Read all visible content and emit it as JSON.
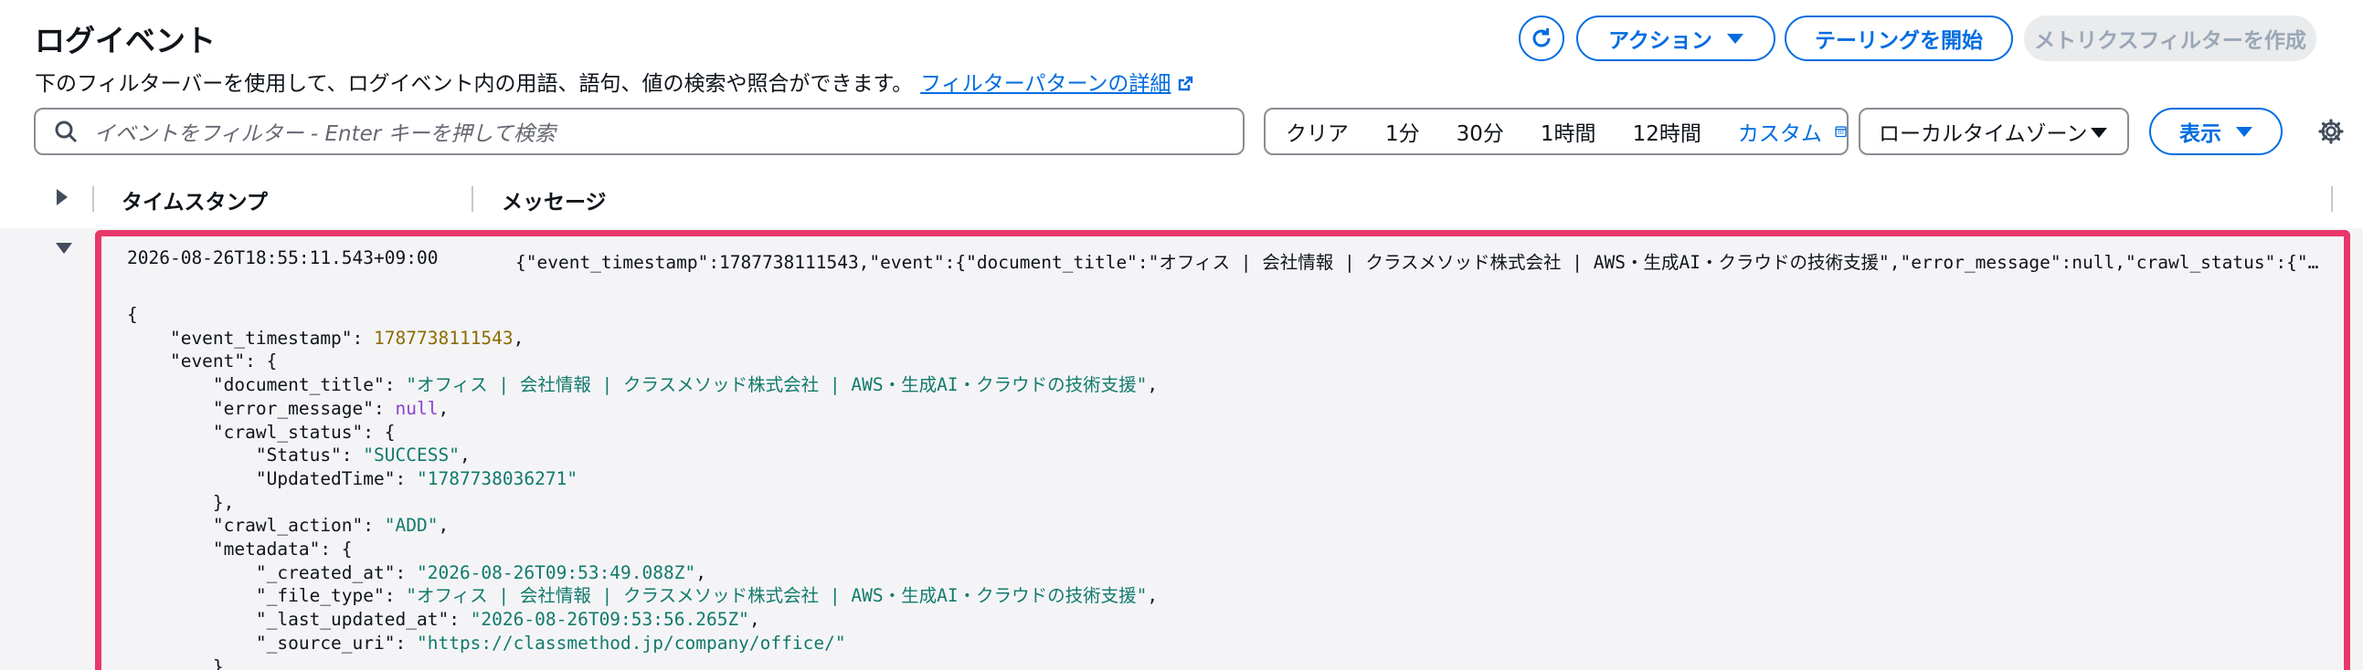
{
  "header": {
    "title": "ログイベント",
    "description": "下のフィルターバーを使用して、ログイベント内の用語、語句、値の検索や照合ができます。",
    "link_label": "フィルターパターンの詳細",
    "actions_label": "アクション",
    "tailing_label": "テーリングを開始",
    "metric_filter_label": "メトリクスフィルターを作成"
  },
  "search": {
    "placeholder": "イベントをフィルター - Enter キーを押して検索"
  },
  "time_range": {
    "clear": "クリア",
    "options": [
      "1分",
      "30分",
      "1時間",
      "12時間"
    ],
    "custom": "カスタム"
  },
  "timezone": {
    "selected": "ローカルタイムゾーン"
  },
  "display_label": "表示",
  "columns": {
    "timestamp": "タイムスタンプ",
    "message": "メッセージ"
  },
  "event": {
    "timestamp": "2026-08-26T18:55:11.543+09:00",
    "message": "{\"event_timestamp\":1787738111543,\"event\":{\"document_title\":\"オフィス | 会社情報 | クラスメソッド株式会社 | AWS・生成AI・クラウドの技術支援\",\"error_message\":null,\"crawl_status\":{\"Status\":\"SUCCESS\",\"UpdatedTime\":\"1787738036271\"}",
    "json": {
      "event_timestamp": "1787738111543",
      "document_title": "\"オフィス | 会社情報 | クラスメソッド株式会社 | AWS・生成AI・クラウドの技術支援\"",
      "error_message": "null",
      "status": "\"SUCCESS\"",
      "updated_time": "\"1787738036271\"",
      "crawl_action": "\"ADD\"",
      "created_at": "\"2026-08-26T09:53:49.088Z\"",
      "file_type": "\"オフィス | 会社情報 | クラスメソッド株式会社 | AWS・生成AI・クラウドの技術支援\"",
      "last_updated_at": "\"2026-08-26T09:53:56.265Z\"",
      "source_uri": "\"https://classmethod.jp/company/office/\""
    }
  },
  "colors": {
    "accent": "#006ce0",
    "highlight": "#e8386a"
  }
}
